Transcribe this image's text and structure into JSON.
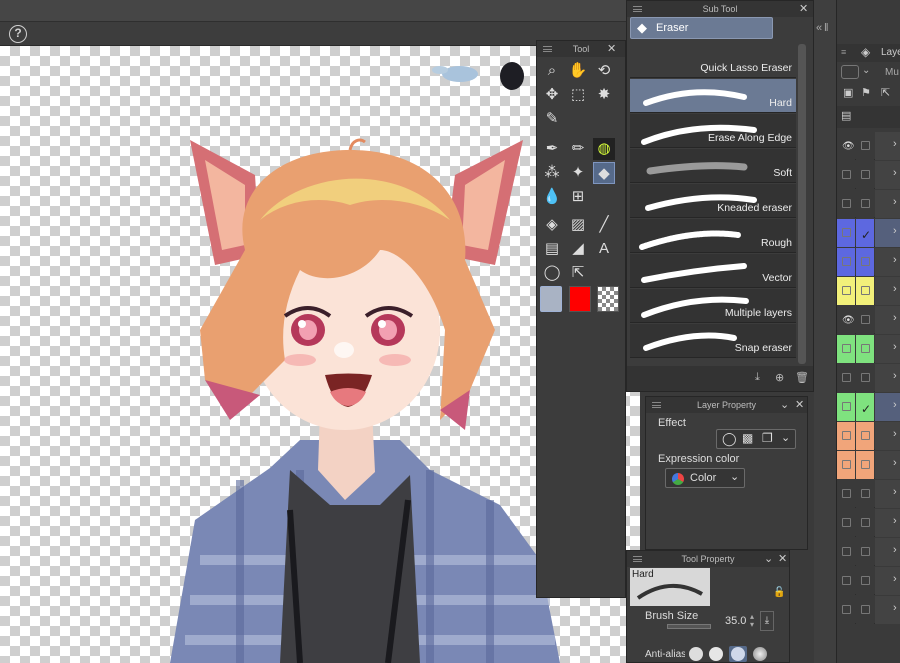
{
  "help": {
    "icon": "help-icon",
    "glyph": "?"
  },
  "tool_panel": {
    "title": "Tool",
    "tools": [
      {
        "name": "zoom-tool-icon",
        "glyph": "⌕"
      },
      {
        "name": "hand-tool-icon",
        "glyph": "✋"
      },
      {
        "name": "rotate-tool-icon",
        "glyph": "⟲"
      },
      {
        "name": "move-tool-icon",
        "glyph": "✥"
      },
      {
        "name": "selection-tool-icon",
        "glyph": "⬚"
      },
      {
        "name": "auto-select-tool-icon",
        "glyph": "✸"
      },
      {
        "name": "eyedropper-tool-icon",
        "glyph": "✎"
      },
      {
        "name": "pen-tool-icon",
        "glyph": "✒"
      },
      {
        "name": "pencil-tool-icon",
        "glyph": "✏"
      },
      {
        "name": "brush-tool-icon",
        "glyph": "◍"
      },
      {
        "name": "airbrush-tool-icon",
        "glyph": "⁂"
      },
      {
        "name": "decoration-tool-icon",
        "glyph": "✦"
      },
      {
        "name": "eraser-tool-icon",
        "glyph": "◆"
      },
      {
        "name": "blend-tool-icon",
        "glyph": "💧"
      },
      {
        "name": "grid-tool-icon",
        "glyph": "⊞"
      },
      {
        "name": "fill-tool-icon",
        "glyph": "◈"
      },
      {
        "name": "gradient-tool-icon",
        "glyph": "▨"
      },
      {
        "name": "line-tool-icon",
        "glyph": "╱"
      },
      {
        "name": "frame-tool-icon",
        "glyph": "▤"
      },
      {
        "name": "ruler-tool-icon",
        "glyph": "◢"
      },
      {
        "name": "text-tool-icon",
        "glyph": "A"
      },
      {
        "name": "balloon-tool-icon",
        "glyph": "◯"
      },
      {
        "name": "correct-line-tool-icon",
        "glyph": "⇱"
      }
    ],
    "colors": {
      "main": "#a9b3c4",
      "sub": "#ff0000"
    }
  },
  "subtool": {
    "title": "Sub Tool",
    "group_label": "Eraser",
    "items": [
      "Quick Lasso Eraser",
      "Hard",
      "Erase Along Edge",
      "Soft",
      "Kneaded eraser",
      "Rough",
      "Vector",
      "Multiple layers",
      "Snap eraser"
    ],
    "selected": "Hard"
  },
  "layer_property": {
    "title": "Layer Property",
    "effect_label": "Effect",
    "expression_label": "Expression color",
    "color_value": "Color"
  },
  "tool_property": {
    "title": "Tool Property",
    "preset_label": "Hard",
    "brush_size_label": "Brush Size",
    "brush_size_value": "35.0",
    "antialias_label": "Anti-aliasing"
  },
  "layer_panel": {
    "title_fragment": "Laye",
    "blend_fragment": "Mu",
    "row_colors": [
      "#3a3a3a",
      "#3a3a3a",
      "#3a3a3a",
      "#5d68e0",
      "#5d68e0",
      "#f2f07a",
      "#3a3a3a",
      "#7fe27f",
      "#3a3a3a",
      "#7fe27f",
      "#f1a57a",
      "#f1a57a",
      "#3a3a3a",
      "#3a3a3a",
      "#3a3a3a",
      "#3a3a3a",
      "#3a3a3a"
    ]
  }
}
